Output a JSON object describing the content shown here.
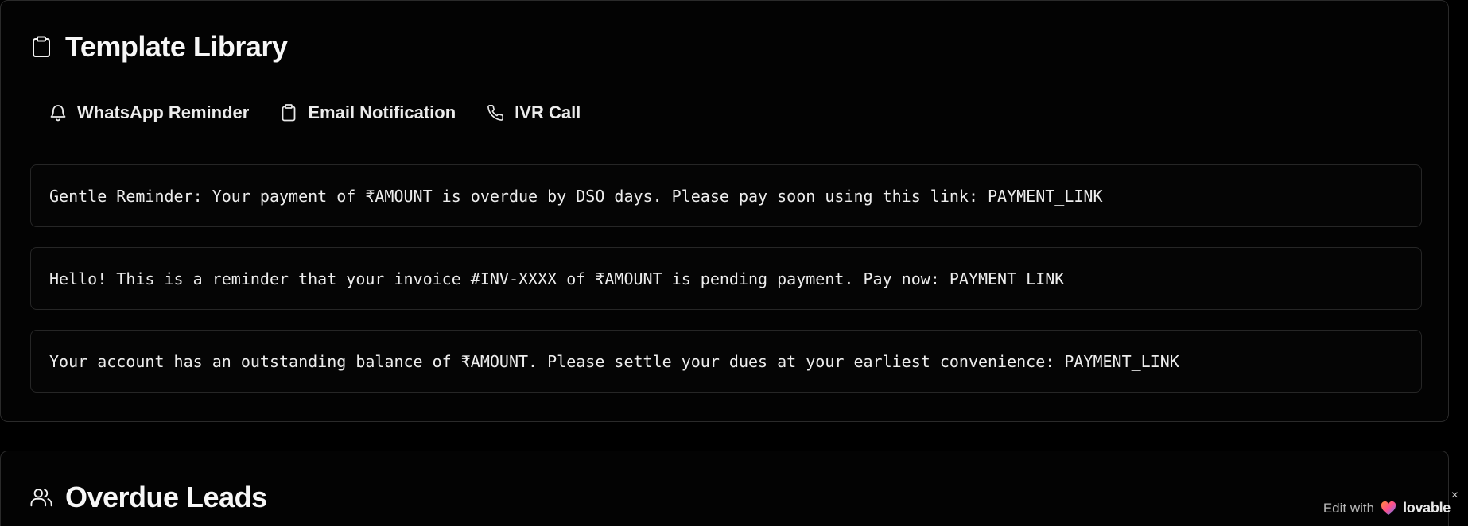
{
  "template_library": {
    "title": "Template Library",
    "icon": "clipboard-icon",
    "tabs": [
      {
        "label": "WhatsApp Reminder",
        "icon": "bell-icon"
      },
      {
        "label": "Email Notification",
        "icon": "clipboard-icon"
      },
      {
        "label": "IVR Call",
        "icon": "phone-icon"
      }
    ],
    "templates": [
      {
        "text": "Gentle Reminder: Your payment of ₹AMOUNT is overdue by DSO days. Please pay soon using this link: PAYMENT_LINK"
      },
      {
        "text": "Hello! This is a reminder that your invoice #INV-XXXX of ₹AMOUNT is pending payment. Pay now: PAYMENT_LINK"
      },
      {
        "text": "Your account has an outstanding balance of ₹AMOUNT. Please settle your dues at your earliest convenience: PAYMENT_LINK"
      }
    ]
  },
  "overdue_leads": {
    "title": "Overdue Leads",
    "icon": "users-icon"
  },
  "badge": {
    "edit_text": "Edit with",
    "brand": "lovable",
    "close": "×",
    "heart_icon": "lovable-heart-icon"
  },
  "colors": {
    "background": "#000000",
    "card_border": "#2a2a2a",
    "text": "#f5f5f5"
  }
}
